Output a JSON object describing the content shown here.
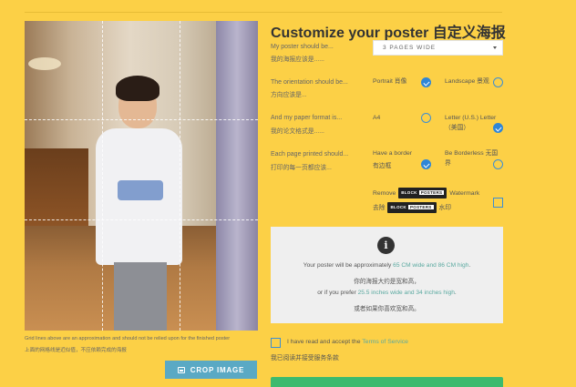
{
  "title": "Customize your poster 自定义海报",
  "preview": {
    "grid_note_en": "Grid lines above are an approximation and should not be relied upon for the finished poster",
    "grid_note_zh": "上面的网格线是近似值，不应依赖完成的海报",
    "crop_button": "CROP IMAGE",
    "crop_icon": "image-icon"
  },
  "rows": {
    "size": {
      "label_en": "My poster should be...",
      "label_zh": "我的海报应该是......",
      "selected": "3 PAGES WIDE"
    },
    "orientation": {
      "label_en": "The orientation should be...",
      "label_zh": "方向应该是...",
      "option1": "Portrait 肖像",
      "option2": "Landscape 景观"
    },
    "format": {
      "label_en": "And my paper format is...",
      "label_zh": "我的论文格式是......",
      "option1": "A4",
      "option2_en": "Letter (U.S.) Letter",
      "option2_zh": "（美国）"
    },
    "border": {
      "label_en": "Each page printed should...",
      "label_zh": "打印的每一页都应该...",
      "option1_en": "Have a border",
      "option1_zh": "有边框",
      "option2_en": "Be Borderless 无国",
      "option2_zh": "界"
    },
    "watermark": {
      "remove_en": "Remove",
      "remove_zh": "去除",
      "badge_prefix": "BLOCK",
      "badge_suffix": "POSTERS",
      "watermark_en": "Watermark",
      "watermark_zh": "水印"
    }
  },
  "info": {
    "icon": "info-icon",
    "line1_pre": "Your poster will be approximately ",
    "line1_hl": "65 CM wide and 86 CM high",
    "line1_post": ".",
    "line2": "你的海报大约是宽和高，",
    "line3_pre": "or if you prefer ",
    "line3_hl": "25.5 inches wide and 34 inches high",
    "line3_post": ".",
    "line4": "或者如果你喜欢宽和高。"
  },
  "tos": {
    "text_pre": "I have read and accept the ",
    "link": "Terms of Service",
    "text_zh": "我已阅读并接受服务条款"
  },
  "colors": {
    "background": "#fcd046",
    "accent_blue": "#2f86d6",
    "crop_button": "#5aa9c4",
    "highlight_green": "#5aa9a0",
    "submit_green": "#3cba6e"
  }
}
